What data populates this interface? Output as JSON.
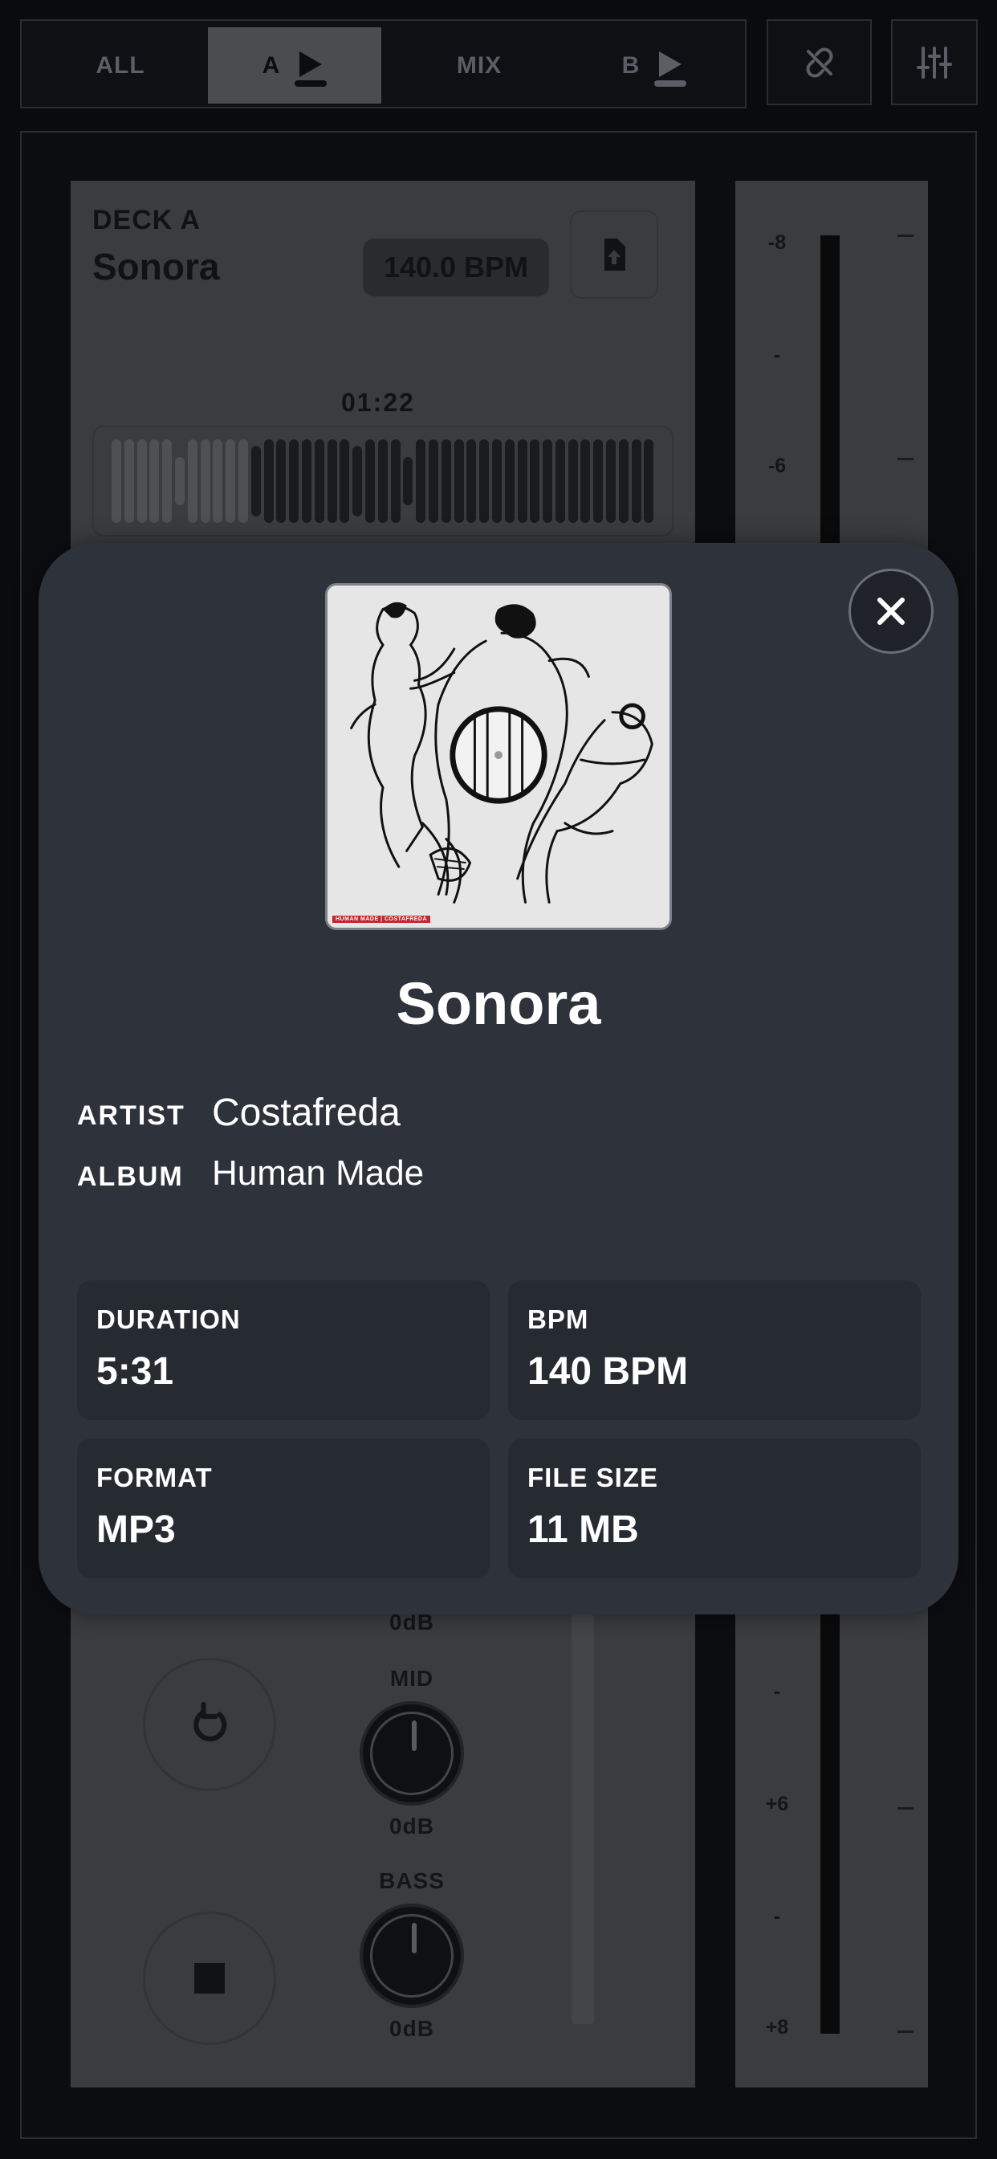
{
  "topbar": {
    "segments": {
      "all": "ALL",
      "a": "A",
      "mix": "MIX",
      "b": "B"
    },
    "active_segment": "A",
    "icons": {
      "sync": "link-off-icon",
      "settings": "sliders-icon"
    }
  },
  "deck": {
    "label": "DECK A",
    "title": "Sonora",
    "bpm": "140.0 BPM",
    "time": "01:22",
    "played_fraction": 0.25,
    "upload_icon": "file-upload-icon",
    "transport_icons": [
      "reset-icon",
      "stop-icon"
    ],
    "eq": [
      {
        "name": "",
        "value": "0dB"
      },
      {
        "name": "MID",
        "value": "0dB"
      },
      {
        "name": "BASS",
        "value": "0dB"
      }
    ]
  },
  "meter": {
    "labels_top": [
      "-8",
      "-",
      "-6"
    ],
    "labels_bottom": [
      "-",
      "+6",
      "-",
      "+8"
    ]
  },
  "modal": {
    "title": "Sonora",
    "artist_key": "ARTIST",
    "artist": "Costafreda",
    "album_key": "ALBUM",
    "album": "Human Made",
    "cover_caption": "HUMAN MADE | COSTAFREDA",
    "cards": [
      {
        "key": "DURATION",
        "value": "5:31"
      },
      {
        "key": "BPM",
        "value": "140 BPM"
      },
      {
        "key": "FORMAT",
        "value": "MP3"
      },
      {
        "key": "FILE SIZE",
        "value": "11 MB"
      }
    ]
  },
  "colors": {
    "modal_bg": "#2d323b",
    "card_bg": "#262a31",
    "page_bg": "#0a0b0d"
  }
}
